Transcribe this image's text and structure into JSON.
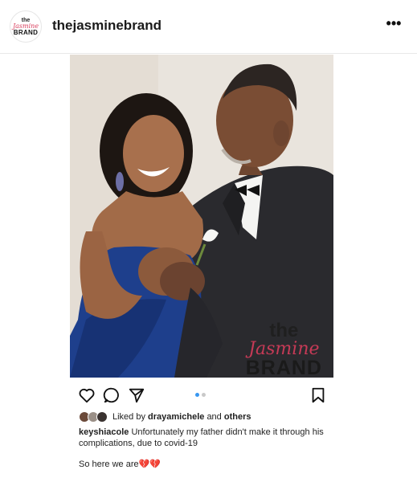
{
  "header": {
    "avatar_line1": "the",
    "avatar_line2": "Jasmine",
    "avatar_line3": "BRAND",
    "username": "thejasminebrand",
    "more_label": "•••"
  },
  "post": {
    "watermark": {
      "line1": "the",
      "line2": "Jasmine",
      "line3": "BRAND"
    },
    "carousel": {
      "current": 1,
      "total": 2
    },
    "likes": {
      "prefix": "Liked by",
      "user": "drayamichele",
      "connector": "and",
      "others": "others"
    },
    "caption": {
      "author": "keyshiacole",
      "text": "Unfortunately my father didn't make it through his complications, due to covid-19",
      "line2": "So here we are",
      "emoji": "💔💔"
    }
  },
  "colors": {
    "brand_pink": "#c53a56",
    "heart": "#c9363d",
    "active_dot": "#3897f0"
  },
  "icons": [
    "heart-icon",
    "comment-icon",
    "share-icon",
    "bookmark-icon",
    "more-icon"
  ]
}
